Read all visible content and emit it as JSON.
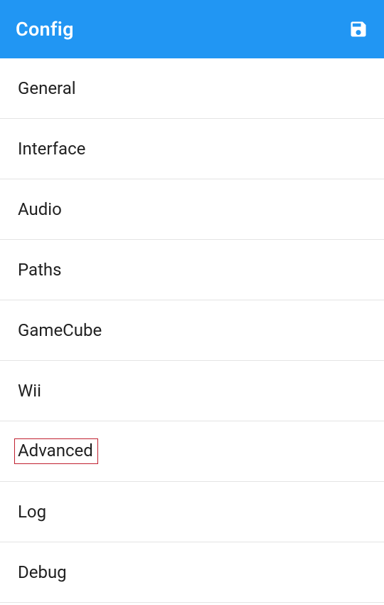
{
  "header": {
    "title": "Config"
  },
  "menu": {
    "items": [
      {
        "label": "General"
      },
      {
        "label": "Interface"
      },
      {
        "label": "Audio"
      },
      {
        "label": "Paths"
      },
      {
        "label": "GameCube"
      },
      {
        "label": "Wii"
      },
      {
        "label": "Advanced",
        "highlighted": true
      },
      {
        "label": "Log"
      },
      {
        "label": "Debug"
      }
    ]
  }
}
